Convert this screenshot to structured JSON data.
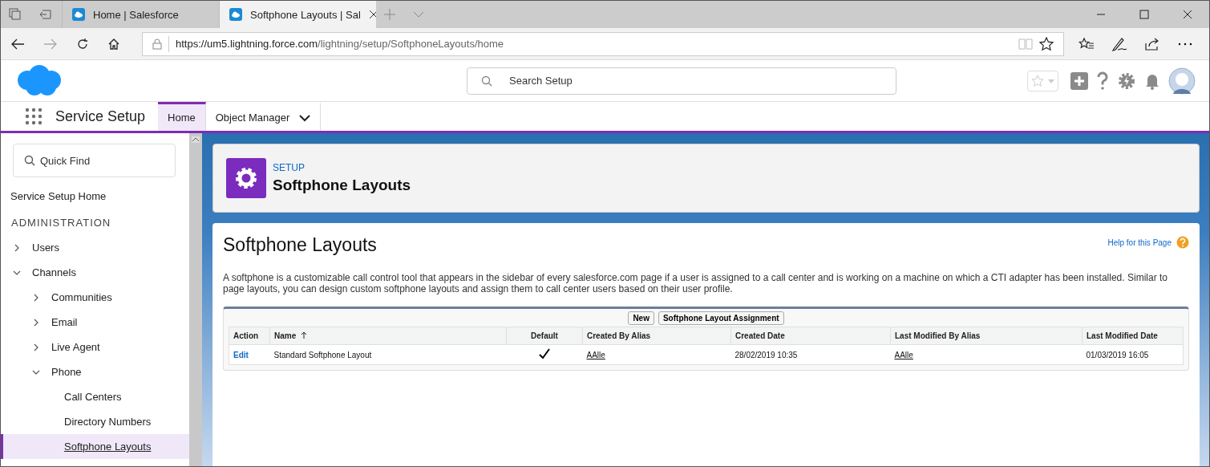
{
  "browser": {
    "tabs": [
      {
        "title": "Home | Salesforce",
        "selected": false
      },
      {
        "title": "Softphone Layouts | Sal",
        "selected": true
      }
    ],
    "url_host": "https://um5.lightning.force.com",
    "url_path": "/lightning/setup/SoftphoneLayouts/home"
  },
  "header": {
    "search": {
      "placeholder": "Search Setup"
    }
  },
  "nav": {
    "app_name": "Service Setup",
    "tabs": [
      {
        "label": "Home",
        "selected": true,
        "kind": "plain"
      },
      {
        "label": "Object Manager",
        "selected": false,
        "kind": "menu"
      }
    ]
  },
  "sidebar": {
    "quick_find": {
      "placeholder": "Quick Find"
    },
    "home_link": "Service Setup Home",
    "section": "ADMINISTRATION",
    "items": [
      {
        "label": "Users",
        "kind": "folder",
        "expanded": false,
        "selected": false
      },
      {
        "label": "Channels",
        "kind": "folder",
        "expanded": true,
        "selected": false,
        "children": [
          {
            "label": "Communities",
            "kind": "folder",
            "expanded": false,
            "selected": false
          },
          {
            "label": "Email",
            "kind": "folder",
            "expanded": false,
            "selected": false
          },
          {
            "label": "Live Agent",
            "kind": "folder",
            "expanded": false,
            "selected": false
          },
          {
            "label": "Phone",
            "kind": "folder",
            "expanded": true,
            "selected": false,
            "children": [
              {
                "label": "Call Centers",
                "kind": "leaf",
                "selected": false
              },
              {
                "label": "Directory Numbers",
                "kind": "leaf",
                "selected": false
              },
              {
                "label": "Softphone Layouts",
                "kind": "leaf",
                "selected": true
              }
            ]
          }
        ]
      }
    ]
  },
  "page_header": {
    "eyebrow": "SETUP",
    "title": "Softphone Layouts"
  },
  "content": {
    "title": "Softphone Layouts",
    "help_link": "Help for this Page",
    "description": "A softphone is a customizable call control tool that appears in the sidebar of every salesforce.com page if a user is assigned to a call center and is working on a machine on which a CTI adapter has been installed. Similar to page layouts, you can design custom softphone layouts and assign them to call center users based on their user profile.",
    "buttons": [
      "New",
      "Softphone Layout Assignment"
    ],
    "table": {
      "columns": [
        {
          "label": "Action",
          "sorted": false
        },
        {
          "label": "Name",
          "sorted": true
        },
        {
          "label": "Default",
          "sorted": false
        },
        {
          "label": "Created By Alias",
          "sorted": false
        },
        {
          "label": "Created Date",
          "sorted": false
        },
        {
          "label": "Last Modified By Alias",
          "sorted": false
        },
        {
          "label": "Last Modified Date",
          "sorted": false
        }
      ],
      "rows": [
        {
          "action": "Edit",
          "name": "Standard Softphone Layout",
          "default": true,
          "created_by": "AAlle",
          "created_date": "28/02/2019 10:35",
          "modified_by": "AAlle",
          "modified_date": "01/03/2019 16:05"
        }
      ]
    }
  }
}
